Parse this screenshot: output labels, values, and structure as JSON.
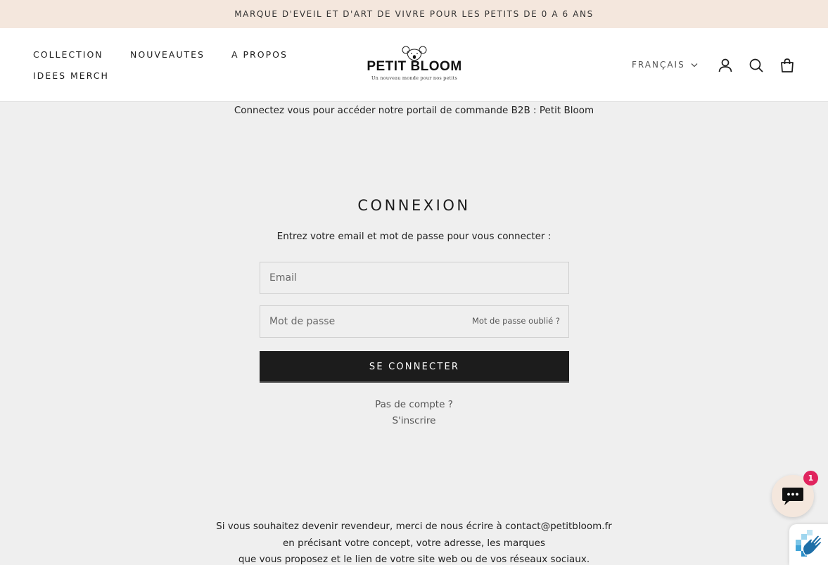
{
  "announcement": "MARQUE D'EVEIL ET D'ART DE VIVRE POUR LES PETITS DE 0 A 6 ANS",
  "nav": {
    "items": [
      "COLLECTION",
      "NOUVEAUTES",
      "A PROPOS",
      "IDEES MERCH"
    ]
  },
  "logo": {
    "name": "PETIT BLOOM",
    "tagline": "Un nouveau monde pour nos petits"
  },
  "header": {
    "language": "FRANÇAIS",
    "icons": [
      "account-icon",
      "search-icon",
      "cart-icon"
    ]
  },
  "notice": "Connectez vous pour accéder notre portail de commande B2B : Petit Bloom",
  "login": {
    "title": "CONNEXION",
    "subtitle": "Entrez votre email et mot de passe pour vous connecter :",
    "email_placeholder": "Email",
    "password_placeholder": "Mot de passe",
    "forgot_label": "Mot de passe oublié ?",
    "submit_label": "SE CONNECTER",
    "no_account": "Pas de compte ?",
    "register_label": "S'inscrire"
  },
  "footer": {
    "line1": "Si vous souhaitez devenir revendeur, merci de nous écrire à contact@petitbloom.fr",
    "line2": "en précisant votre concept, votre adresse, les marques",
    "line3": "que vous proposez et le lien de votre site web ou de vos réseaux sociaux."
  },
  "chat": {
    "badge_count": "1"
  },
  "colors": {
    "announcement_bg": "#f4e7dd",
    "page_bg": "#efefef",
    "button_bg": "#1c1c1c",
    "badge": "#e0245e"
  }
}
